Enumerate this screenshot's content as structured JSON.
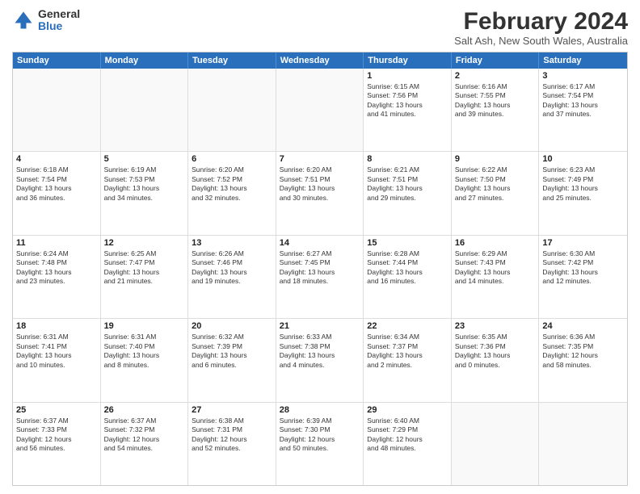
{
  "logo": {
    "general": "General",
    "blue": "Blue"
  },
  "header": {
    "month_year": "February 2024",
    "location": "Salt Ash, New South Wales, Australia"
  },
  "days_of_week": [
    "Sunday",
    "Monday",
    "Tuesday",
    "Wednesday",
    "Thursday",
    "Friday",
    "Saturday"
  ],
  "weeks": [
    [
      {
        "day": "",
        "info": ""
      },
      {
        "day": "",
        "info": ""
      },
      {
        "day": "",
        "info": ""
      },
      {
        "day": "",
        "info": ""
      },
      {
        "day": "1",
        "info": "Sunrise: 6:15 AM\nSunset: 7:56 PM\nDaylight: 13 hours\nand 41 minutes."
      },
      {
        "day": "2",
        "info": "Sunrise: 6:16 AM\nSunset: 7:55 PM\nDaylight: 13 hours\nand 39 minutes."
      },
      {
        "day": "3",
        "info": "Sunrise: 6:17 AM\nSunset: 7:54 PM\nDaylight: 13 hours\nand 37 minutes."
      }
    ],
    [
      {
        "day": "4",
        "info": "Sunrise: 6:18 AM\nSunset: 7:54 PM\nDaylight: 13 hours\nand 36 minutes."
      },
      {
        "day": "5",
        "info": "Sunrise: 6:19 AM\nSunset: 7:53 PM\nDaylight: 13 hours\nand 34 minutes."
      },
      {
        "day": "6",
        "info": "Sunrise: 6:20 AM\nSunset: 7:52 PM\nDaylight: 13 hours\nand 32 minutes."
      },
      {
        "day": "7",
        "info": "Sunrise: 6:20 AM\nSunset: 7:51 PM\nDaylight: 13 hours\nand 30 minutes."
      },
      {
        "day": "8",
        "info": "Sunrise: 6:21 AM\nSunset: 7:51 PM\nDaylight: 13 hours\nand 29 minutes."
      },
      {
        "day": "9",
        "info": "Sunrise: 6:22 AM\nSunset: 7:50 PM\nDaylight: 13 hours\nand 27 minutes."
      },
      {
        "day": "10",
        "info": "Sunrise: 6:23 AM\nSunset: 7:49 PM\nDaylight: 13 hours\nand 25 minutes."
      }
    ],
    [
      {
        "day": "11",
        "info": "Sunrise: 6:24 AM\nSunset: 7:48 PM\nDaylight: 13 hours\nand 23 minutes."
      },
      {
        "day": "12",
        "info": "Sunrise: 6:25 AM\nSunset: 7:47 PM\nDaylight: 13 hours\nand 21 minutes."
      },
      {
        "day": "13",
        "info": "Sunrise: 6:26 AM\nSunset: 7:46 PM\nDaylight: 13 hours\nand 19 minutes."
      },
      {
        "day": "14",
        "info": "Sunrise: 6:27 AM\nSunset: 7:45 PM\nDaylight: 13 hours\nand 18 minutes."
      },
      {
        "day": "15",
        "info": "Sunrise: 6:28 AM\nSunset: 7:44 PM\nDaylight: 13 hours\nand 16 minutes."
      },
      {
        "day": "16",
        "info": "Sunrise: 6:29 AM\nSunset: 7:43 PM\nDaylight: 13 hours\nand 14 minutes."
      },
      {
        "day": "17",
        "info": "Sunrise: 6:30 AM\nSunset: 7:42 PM\nDaylight: 13 hours\nand 12 minutes."
      }
    ],
    [
      {
        "day": "18",
        "info": "Sunrise: 6:31 AM\nSunset: 7:41 PM\nDaylight: 13 hours\nand 10 minutes."
      },
      {
        "day": "19",
        "info": "Sunrise: 6:31 AM\nSunset: 7:40 PM\nDaylight: 13 hours\nand 8 minutes."
      },
      {
        "day": "20",
        "info": "Sunrise: 6:32 AM\nSunset: 7:39 PM\nDaylight: 13 hours\nand 6 minutes."
      },
      {
        "day": "21",
        "info": "Sunrise: 6:33 AM\nSunset: 7:38 PM\nDaylight: 13 hours\nand 4 minutes."
      },
      {
        "day": "22",
        "info": "Sunrise: 6:34 AM\nSunset: 7:37 PM\nDaylight: 13 hours\nand 2 minutes."
      },
      {
        "day": "23",
        "info": "Sunrise: 6:35 AM\nSunset: 7:36 PM\nDaylight: 13 hours\nand 0 minutes."
      },
      {
        "day": "24",
        "info": "Sunrise: 6:36 AM\nSunset: 7:35 PM\nDaylight: 12 hours\nand 58 minutes."
      }
    ],
    [
      {
        "day": "25",
        "info": "Sunrise: 6:37 AM\nSunset: 7:33 PM\nDaylight: 12 hours\nand 56 minutes."
      },
      {
        "day": "26",
        "info": "Sunrise: 6:37 AM\nSunset: 7:32 PM\nDaylight: 12 hours\nand 54 minutes."
      },
      {
        "day": "27",
        "info": "Sunrise: 6:38 AM\nSunset: 7:31 PM\nDaylight: 12 hours\nand 52 minutes."
      },
      {
        "day": "28",
        "info": "Sunrise: 6:39 AM\nSunset: 7:30 PM\nDaylight: 12 hours\nand 50 minutes."
      },
      {
        "day": "29",
        "info": "Sunrise: 6:40 AM\nSunset: 7:29 PM\nDaylight: 12 hours\nand 48 minutes."
      },
      {
        "day": "",
        "info": ""
      },
      {
        "day": "",
        "info": ""
      }
    ]
  ]
}
